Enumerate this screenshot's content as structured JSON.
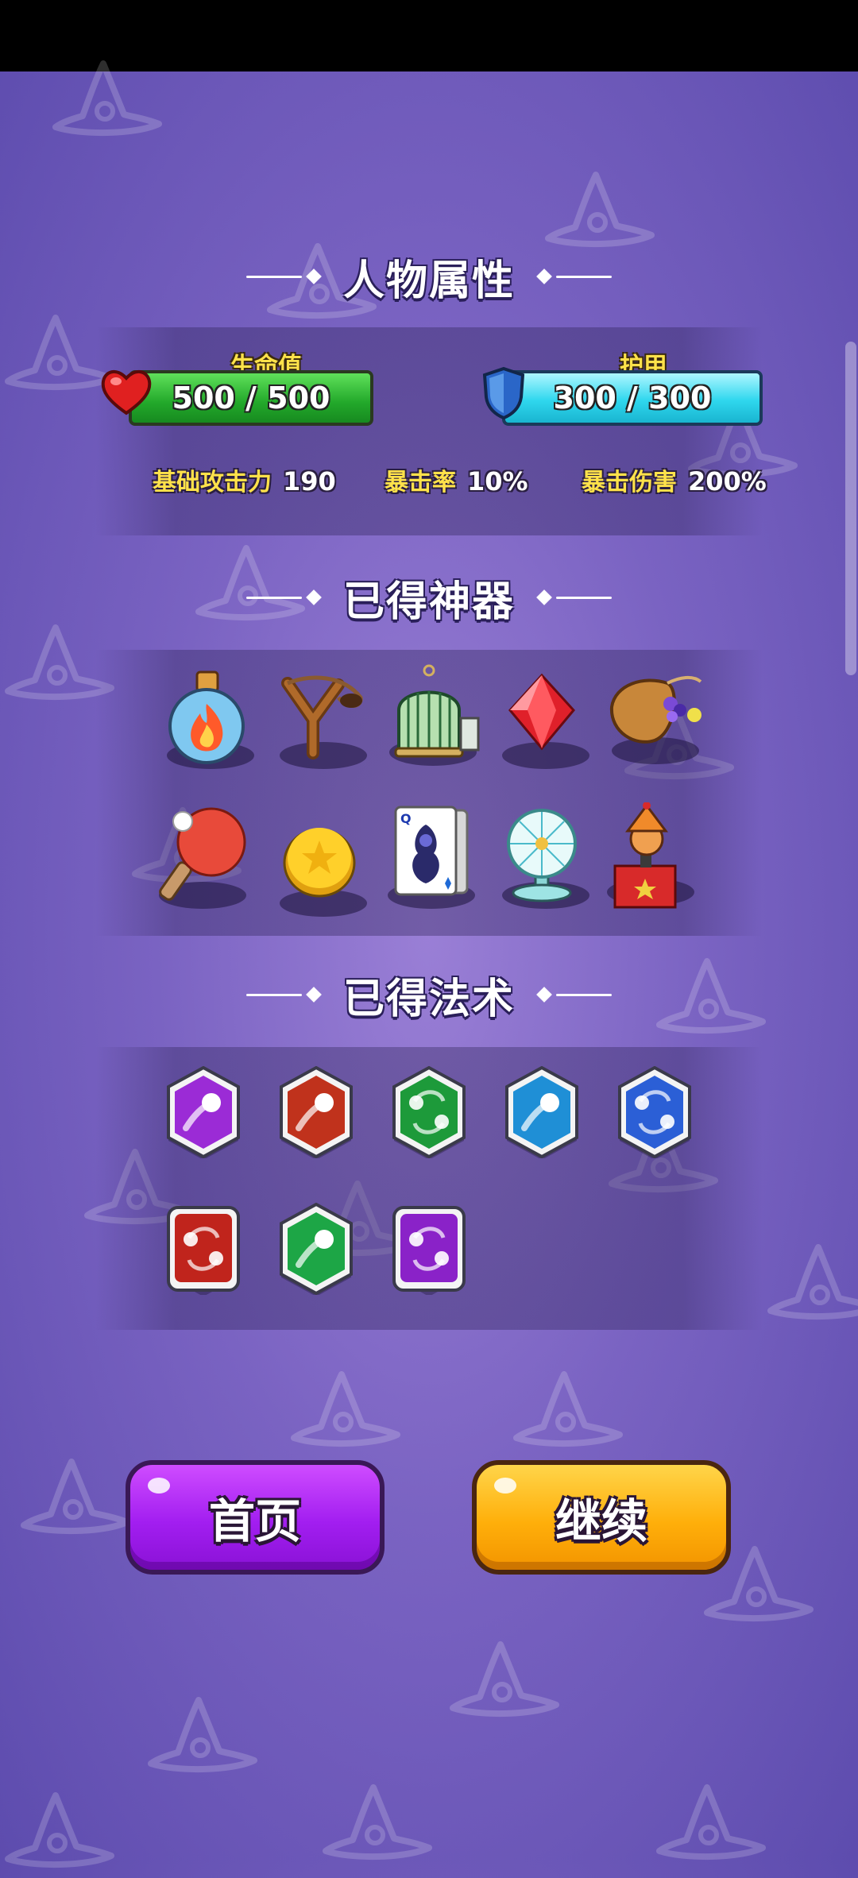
{
  "sections": {
    "attributes_title": "人物属性",
    "artifacts_title": "已得神器",
    "spells_title": "已得法术"
  },
  "stats": {
    "hp_label": "生命值",
    "hp_value": "500 / 500",
    "hp_fill": 1.0,
    "armor_label": "护甲",
    "armor_value": "300 / 300",
    "armor_fill": 1.0,
    "attack_label": "基础攻击力",
    "attack_value": "190",
    "crit_rate_label": "暴击率",
    "crit_rate_value": "10%",
    "crit_damage_label": "暴击伤害",
    "crit_damage_value": "200%"
  },
  "artifacts": [
    {
      "icon": "fire-potion-icon"
    },
    {
      "icon": "slingshot-icon"
    },
    {
      "icon": "birdcage-icon"
    },
    {
      "icon": "red-gem-icon"
    },
    {
      "icon": "marble-bag-icon"
    },
    {
      "icon": "ping-pong-paddle-icon"
    },
    {
      "icon": "gold-coin-icon"
    },
    {
      "icon": "queen-card-icon"
    },
    {
      "icon": "electric-fan-icon"
    },
    {
      "icon": "jack-in-the-box-icon"
    }
  ],
  "spells": [
    {
      "icon": "purple-orb-spell-icon",
      "color": "#9b2bd6"
    },
    {
      "icon": "red-orb-spell-icon",
      "color": "#c0321c"
    },
    {
      "icon": "green-orbit-spell-icon",
      "color": "#1d9a3a"
    },
    {
      "icon": "blue-orb-spell-icon",
      "color": "#1f8fd6"
    },
    {
      "icon": "blue-orbit-spell-icon",
      "color": "#2b5fd6"
    },
    {
      "icon": "red-orbit-spell-icon",
      "color": "#c0241c"
    },
    {
      "icon": "green-orb-spell-icon",
      "color": "#1da646"
    },
    {
      "icon": "purple-orbit-spell-icon",
      "color": "#8a22c8"
    }
  ],
  "buttons": {
    "home_label": "首页",
    "continue_label": "继续"
  },
  "colors": {
    "hp_bar": "#22a82a",
    "armor_bar": "#2fd7ee",
    "stat_label": "#ffe24a",
    "home_button": "#a21ef0",
    "continue_button": "#ffaf0a"
  }
}
